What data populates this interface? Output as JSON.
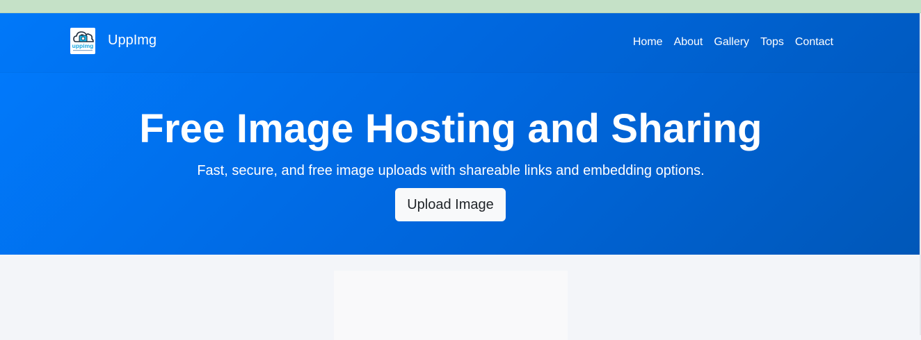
{
  "brand": {
    "name": "UppImg",
    "logo_text": "uppimg",
    "logo_icon": "cloud-camera-logo"
  },
  "nav": {
    "items": [
      {
        "label": "Home"
      },
      {
        "label": "About"
      },
      {
        "label": "Gallery"
      },
      {
        "label": "Tops"
      },
      {
        "label": "Contact"
      }
    ]
  },
  "hero": {
    "title": "Free Image Hosting and Sharing",
    "subtitle": "Fast, secure, and free image uploads with shareable links and embedding options.",
    "upload_label": "Upload Image"
  },
  "colors": {
    "hero_start": "#017bfe",
    "hero_end": "#0057b8",
    "browser_strip": "#c5e1c7",
    "page_background": "#f3f5f9",
    "button_background": "#f8f9fa"
  }
}
